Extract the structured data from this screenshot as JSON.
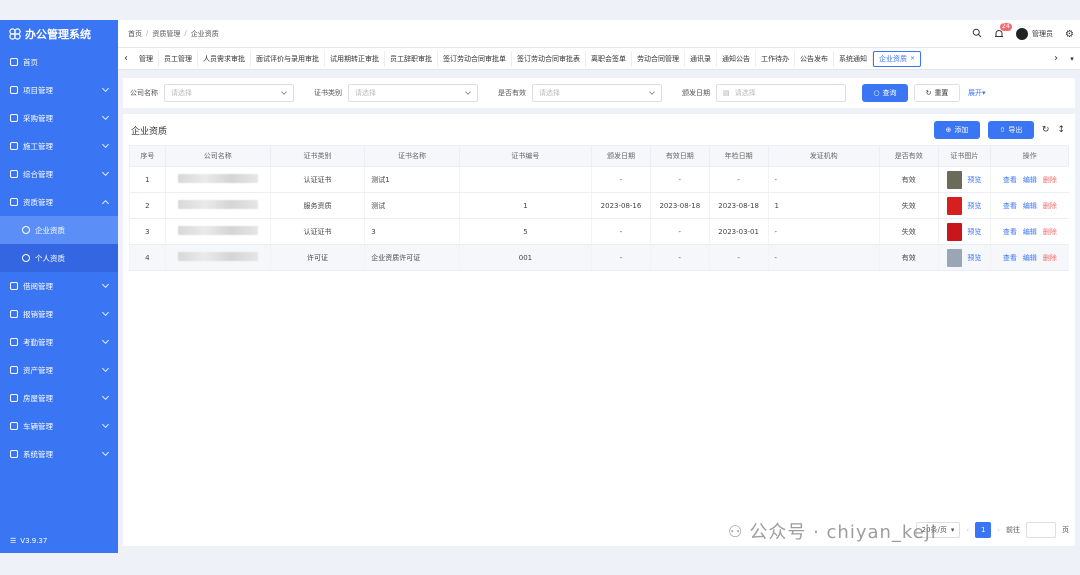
{
  "app": {
    "title": "办公管理系统",
    "version": "V3.9.37"
  },
  "sidebar": {
    "items": [
      {
        "label": "首页",
        "icon": "home-icon",
        "arrow": false
      },
      {
        "label": "项目管理",
        "icon": "project-icon",
        "arrow": true
      },
      {
        "label": "采购管理",
        "icon": "purchase-icon",
        "arrow": true
      },
      {
        "label": "施工管理",
        "icon": "construction-icon",
        "arrow": true
      },
      {
        "label": "综合管理",
        "icon": "general-icon",
        "arrow": true
      },
      {
        "label": "资质管理",
        "icon": "qualification-icon",
        "arrow": true,
        "expanded": true
      },
      {
        "label": "企业资质",
        "icon": "company-icon",
        "sub": true,
        "active": true
      },
      {
        "label": "个人资质",
        "icon": "person-icon",
        "sub": true
      },
      {
        "label": "借阅管理",
        "icon": "borrow-icon",
        "arrow": true
      },
      {
        "label": "报销管理",
        "icon": "reimburse-icon",
        "arrow": true
      },
      {
        "label": "考勤管理",
        "icon": "attendance-icon",
        "arrow": true
      },
      {
        "label": "资产管理",
        "icon": "asset-icon",
        "arrow": true
      },
      {
        "label": "房屋管理",
        "icon": "house-icon",
        "arrow": true
      },
      {
        "label": "车辆管理",
        "icon": "car-icon",
        "arrow": true
      },
      {
        "label": "系统管理",
        "icon": "settings-icon",
        "arrow": true
      }
    ]
  },
  "header": {
    "breadcrumb": [
      "首页",
      "资质管理",
      "企业资质"
    ],
    "notification_count": "24",
    "user": "管理员"
  },
  "tabs": [
    "管理",
    "员工管理",
    "人员需求审批",
    "面试评价与录用审批",
    "试用期转正审批",
    "员工辞职审批",
    "签订劳动合同审批单",
    "签订劳动合同审批表",
    "离职会签单",
    "劳动合同管理",
    "通讯录",
    "通知公告",
    "工作待办",
    "公告发布",
    "系统通知",
    "企业资质"
  ],
  "filters": {
    "company_label": "公司名称",
    "company_placeholder": "请选择",
    "cert_type_label": "证书类别",
    "cert_type_placeholder": "请选择",
    "valid_label": "是否有效",
    "valid_placeholder": "请选择",
    "issue_date_label": "颁发日期",
    "issue_date_placeholder": "请选择",
    "search": "查询",
    "reset": "重置",
    "expand": "展开"
  },
  "panel": {
    "title": "企业资质",
    "add": "添加",
    "export": "导出"
  },
  "table": {
    "headers": [
      "序号",
      "公司名称",
      "证书类别",
      "证书名称",
      "证书编号",
      "颁发日期",
      "有效日期",
      "年检日期",
      "发证机构",
      "是否有效",
      "证书图片",
      "操作"
    ],
    "rows": [
      {
        "no": "1",
        "type": "认证证书",
        "name": "测试1",
        "code": "",
        "issue": "-",
        "valid_date": "-",
        "annual": "-",
        "org": "-",
        "valid": "有效",
        "thumb": "#6b6b5a"
      },
      {
        "no": "2",
        "type": "服务资质",
        "name": "测试",
        "code": "1",
        "issue": "2023-08-16",
        "valid_date": "2023-08-18",
        "annual": "2023-08-18",
        "org": "1",
        "valid": "失效",
        "thumb": "#d61f1f"
      },
      {
        "no": "3",
        "type": "认证证书",
        "name": "3",
        "code": "5",
        "issue": "-",
        "valid_date": "-",
        "annual": "2023-03-01",
        "org": "-",
        "valid": "失效",
        "thumb": "#c8161d"
      },
      {
        "no": "4",
        "type": "许可证",
        "name": "企业资质许可证",
        "code": "001",
        "issue": "-",
        "valid_date": "-",
        "annual": "-",
        "org": "-",
        "valid": "有效",
        "thumb": "#9aa6b3"
      }
    ],
    "preview": "预览",
    "view": "查看",
    "edit": "编辑",
    "delete": "删除"
  },
  "pager": {
    "page_size": "20条/页",
    "current": "1",
    "goto_label": "前往",
    "page_unit": "页"
  },
  "watermark": "公众号 · chiyan_keji",
  "colors": {
    "primary": "#3a75f3",
    "danger": "#f56c6c"
  }
}
